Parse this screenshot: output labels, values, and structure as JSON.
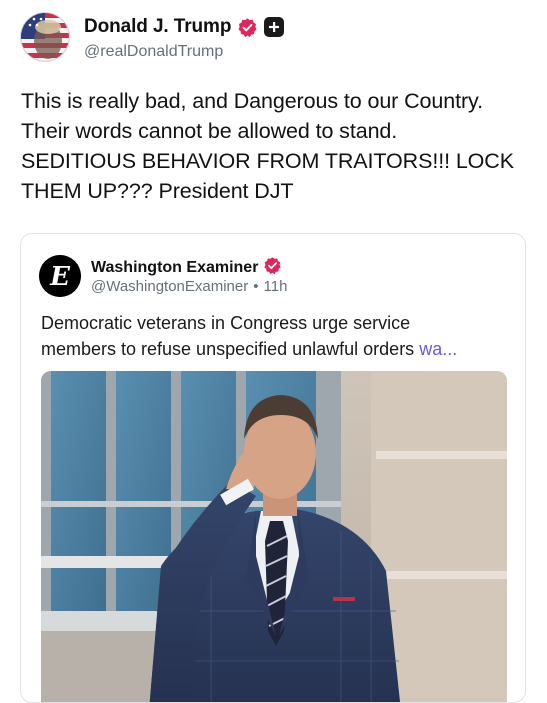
{
  "author": {
    "name": "Donald J. Trump",
    "handle": "@realDonaldTrump",
    "verified": true,
    "brand_color": "#e0245e"
  },
  "post": {
    "lines": [
      "This is really bad, and Dangerous to our Country.",
      "Their words cannot be allowed to stand.",
      "SEDITIOUS BEHAVIOR FROM TRAITORS!!! LOCK",
      "THEM UP??? President DJT"
    ]
  },
  "quoted": {
    "name": "Washington Examiner",
    "handle": "@WashingtonExaminer",
    "separator": "•",
    "time": "11h",
    "text_line1": "Democratic veterans in Congress urge service",
    "text_line2": "members to refuse unspecified unlawful orders",
    "more_label": "wa...",
    "logo_letter": "E"
  },
  "icons": {
    "verified": "verified-badge-icon",
    "subscribe": "plus-badge-icon"
  },
  "colors": {
    "verified_pink": "#e0245e",
    "link_purple": "#6f55d9",
    "muted": "#66707a"
  }
}
